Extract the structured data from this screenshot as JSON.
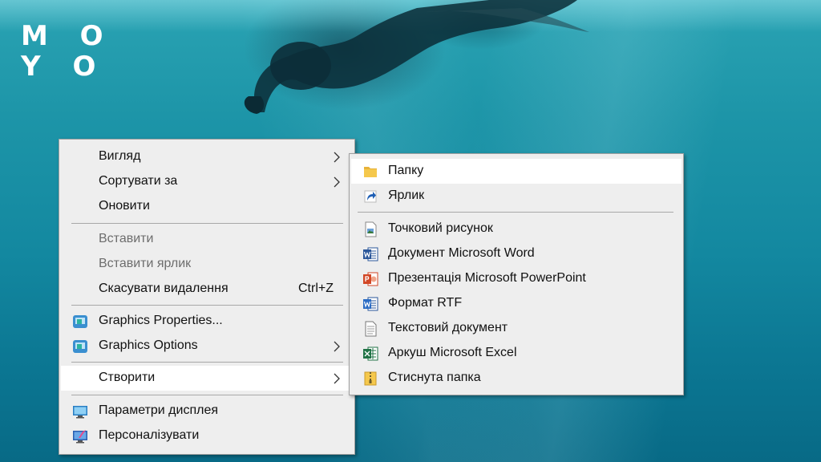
{
  "brand": {
    "logo_line1": "M O",
    "logo_line2": "Y O"
  },
  "context_menu": {
    "items": [
      {
        "label": "Вигляд"
      },
      {
        "label": "Сортувати за"
      },
      {
        "label": "Оновити"
      },
      {
        "label": "Вставити"
      },
      {
        "label": "Вставити ярлик"
      },
      {
        "label": "Скасувати видалення",
        "shortcut": "Ctrl+Z"
      },
      {
        "label": "Graphics Properties..."
      },
      {
        "label": "Graphics Options"
      },
      {
        "label": "Створити"
      },
      {
        "label": "Параметри дисплея"
      },
      {
        "label": "Персоналізувати"
      }
    ]
  },
  "new_submenu": {
    "items": [
      {
        "label": "Папку"
      },
      {
        "label": "Ярлик"
      },
      {
        "label": "Точковий рисунок"
      },
      {
        "label": "Документ Microsoft Word"
      },
      {
        "label": "Презентація Microsoft PowerPoint"
      },
      {
        "label": "Формат RTF"
      },
      {
        "label": "Текстовий документ"
      },
      {
        "label": "Аркуш Microsoft Excel"
      },
      {
        "label": "Стиснута папка"
      }
    ]
  },
  "colors": {
    "menu_bg": "#eeeeee",
    "highlight": "#ffffff",
    "disabled_text": "#6d6d6d",
    "word_blue": "#2b579a",
    "powerpoint_red": "#d24726",
    "excel_green": "#217346",
    "folder_yellow": "#f5c84c"
  },
  "icons": {
    "folder": "folder-icon",
    "shortcut": "shortcut-arrow-icon",
    "bitmap": "bitmap-image-icon",
    "word": "word-document-icon",
    "powerpoint": "powerpoint-icon",
    "rtf": "rtf-document-icon",
    "text": "text-document-icon",
    "excel": "excel-icon",
    "zip": "zip-folder-icon",
    "graphics": "intel-graphics-icon",
    "display": "display-settings-icon",
    "personalize": "personalize-icon"
  }
}
